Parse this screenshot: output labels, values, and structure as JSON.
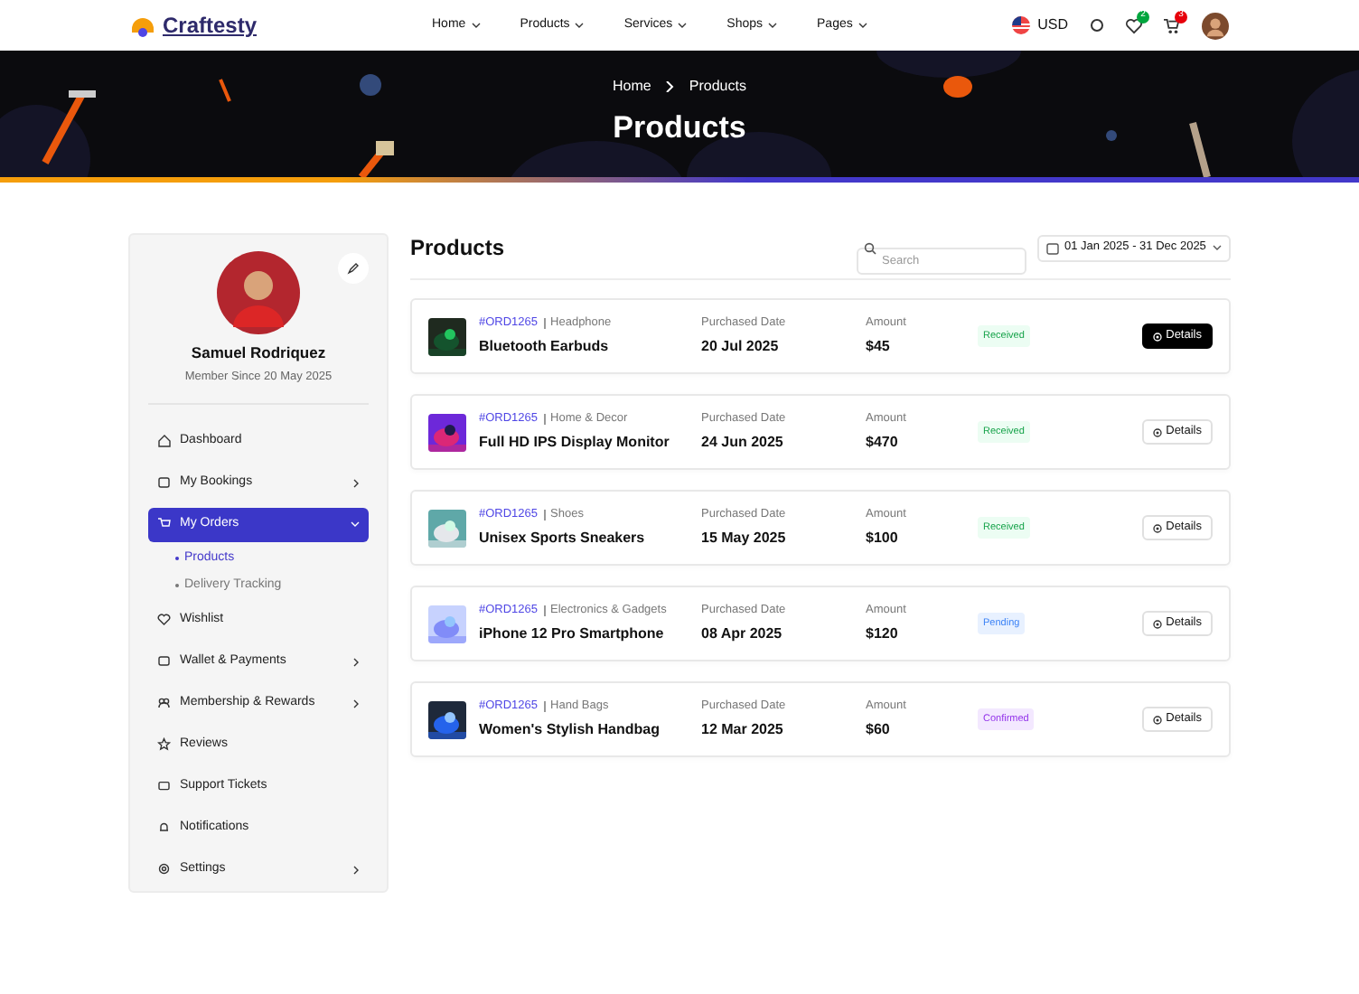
{
  "header": {
    "logo": "Craftesty",
    "nav": [
      {
        "label": "Home"
      },
      {
        "label": "Products"
      },
      {
        "label": "Services"
      },
      {
        "label": "Shops"
      },
      {
        "label": "Pages"
      }
    ],
    "currency": "USD",
    "wishlist_count": "2",
    "cart_count": "3"
  },
  "banner": {
    "breadcrumb": [
      "Home",
      "Products"
    ],
    "title": "Products"
  },
  "profile": {
    "name": "Samuel Rodriquez",
    "member_since": "Member Since 20 May 2025"
  },
  "sidebar": {
    "items": [
      {
        "label": "Dashboard",
        "kind": "link",
        "selected": false,
        "expanded": false
      },
      {
        "label": "My Bookings",
        "kind": "submenu",
        "selected": false,
        "expanded": false
      },
      {
        "label": "My Orders",
        "kind": "submenu",
        "selected": true,
        "expanded": true,
        "children": [
          {
            "label": "Products",
            "selected": true
          },
          {
            "label": "Delivery Tracking",
            "selected": false
          }
        ]
      },
      {
        "label": "Wishlist",
        "kind": "link",
        "selected": false,
        "expanded": false
      },
      {
        "label": "Wallet & Payments",
        "kind": "submenu",
        "selected": false,
        "expanded": false
      },
      {
        "label": "Membership & Rewards",
        "kind": "submenu",
        "selected": false,
        "expanded": false
      },
      {
        "label": "Reviews",
        "kind": "link",
        "selected": false,
        "expanded": false
      },
      {
        "label": "Support Tickets",
        "kind": "link",
        "selected": false,
        "expanded": false
      },
      {
        "label": "Notifications",
        "kind": "link",
        "selected": false,
        "expanded": false
      },
      {
        "label": "Settings",
        "kind": "submenu",
        "selected": false,
        "expanded": false
      }
    ]
  },
  "main": {
    "title": "Products",
    "search": {
      "placeholder": "Search"
    },
    "date_range": "01 Jan 2025 - 31 Dec 2025",
    "orders": [
      {
        "order_id": "#ORD1265",
        "category": "Headphone",
        "product": "Bluetooth Earbuds",
        "date_label": "Purchased Date",
        "date": "20 Jul 2025",
        "amount_label": "Amount",
        "amount": "$45",
        "status": "Received",
        "color": "#16a34a",
        "button": "Details",
        "selected": true
      },
      {
        "order_id": "#ORD1265",
        "category": "Home & Decor",
        "product": "Full HD IPS Display Monitor",
        "date_label": "Purchased Date",
        "date": "24 Jun 2025",
        "amount_label": "Amount",
        "amount": "$470",
        "status": "Received",
        "color": "#16a34a",
        "button": "Details",
        "selected": false
      },
      {
        "order_id": "#ORD1265",
        "category": "Shoes",
        "product": "Unisex Sports Sneakers",
        "date_label": "Purchased Date",
        "date": "15 May 2025",
        "amount_label": "Amount",
        "amount": "$100",
        "status": "Received",
        "color": "#16a34a",
        "button": "Details",
        "selected": false
      },
      {
        "order_id": "#ORD1265",
        "category": "Electronics & Gadgets",
        "product": "iPhone 12 Pro Smartphone",
        "date_label": "Purchased Date",
        "date": "08 Apr 2025",
        "amount_label": "Amount",
        "amount": "$120",
        "status": "Pending",
        "color": "#3b82f6",
        "button": "Details",
        "selected": false
      },
      {
        "order_id": "#ORD1265",
        "category": "Hand Bags",
        "product": "Women's Stylish Handbag",
        "date_label": "Purchased Date",
        "date": "12 Mar 2025",
        "amount_label": "Amount",
        "amount": "$60",
        "status": "Confirmed",
        "color": "#9333ea",
        "button": "Details",
        "selected": false
      }
    ]
  }
}
